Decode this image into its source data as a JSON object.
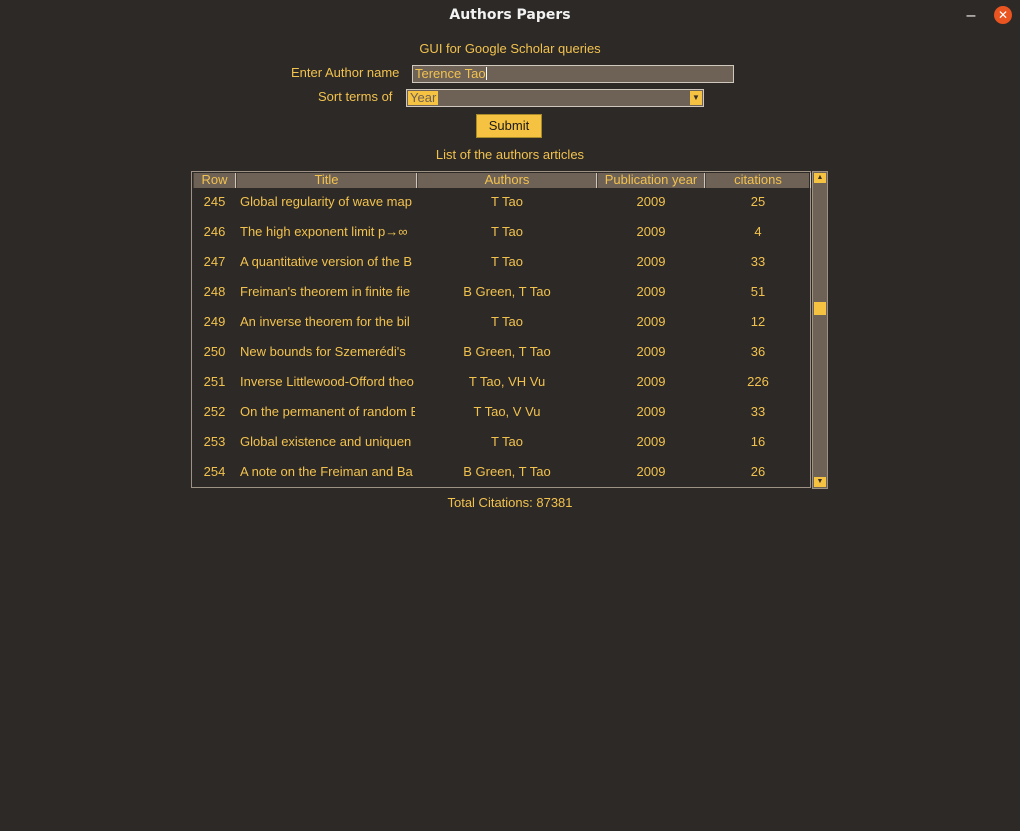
{
  "window": {
    "title": "Authors Papers"
  },
  "form": {
    "heading": "GUI for Google Scholar queries",
    "author_label": "Enter Author name",
    "author_value": "Terence Tao",
    "sort_label": "Sort terms of",
    "sort_value": "Year",
    "submit_label": "Submit"
  },
  "list_heading": "List of the authors articles",
  "table": {
    "columns": [
      "Row",
      "Title",
      "Authors",
      "Publication year",
      "citations"
    ],
    "rows": [
      {
        "row": "245",
        "title": "Global regularity of wave map",
        "authors": "T Tao",
        "year": "2009",
        "citations": "25"
      },
      {
        "row": "246",
        "title": "The high exponent limit p→∞",
        "authors": "T Tao",
        "year": "2009",
        "citations": "4"
      },
      {
        "row": "247",
        "title": "A quantitative version of the B",
        "authors": "T Tao",
        "year": "2009",
        "citations": "33"
      },
      {
        "row": "248",
        "title": "Freiman's theorem in finite fie",
        "authors": "B Green, T Tao",
        "year": "2009",
        "citations": "51"
      },
      {
        "row": "249",
        "title": "An inverse theorem for the bil",
        "authors": "T Tao",
        "year": "2009",
        "citations": "12"
      },
      {
        "row": "250",
        "title": "New bounds for Szemerédi's",
        "authors": "B Green, T Tao",
        "year": "2009",
        "citations": "36"
      },
      {
        "row": "251",
        "title": "Inverse Littlewood-Offord theo",
        "authors": "T Tao, VH Vu",
        "year": "2009",
        "citations": "226"
      },
      {
        "row": "252",
        "title": "On the permanent of random B",
        "authors": "T Tao, V Vu",
        "year": "2009",
        "citations": "33"
      },
      {
        "row": "253",
        "title": "Global existence and uniquen",
        "authors": "T Tao",
        "year": "2009",
        "citations": "16"
      },
      {
        "row": "254",
        "title": "A note on the Freiman and Ba",
        "authors": "B Green, T Tao",
        "year": "2009",
        "citations": "26"
      }
    ]
  },
  "total_citations": "Total Citations: 87381",
  "colors": {
    "background": "#2c2926",
    "text": "#f2c24f",
    "field": "#6e6156",
    "accent": "#f5c242",
    "close": "#e95420"
  },
  "icons": {
    "minimize": "minimize-icon",
    "close": "close-icon",
    "dropdown": "chevron-down-icon"
  }
}
